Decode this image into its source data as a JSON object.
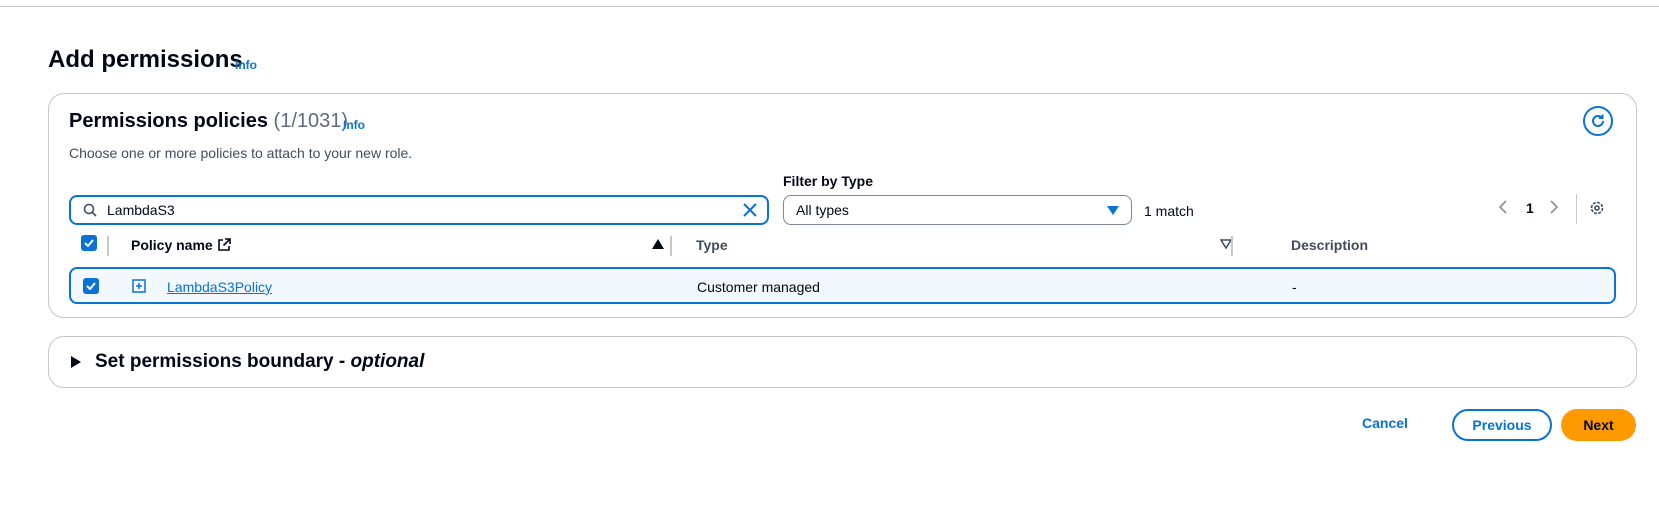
{
  "page": {
    "title": "Add permissions",
    "info": "Info"
  },
  "policies": {
    "title": "Permissions policies",
    "count": "(1/1031)",
    "info": "Info",
    "description": "Choose one or more policies to attach to your new role.",
    "search_value": "LambdaS3",
    "filter_label": "Filter by Type",
    "filter_value": "All types",
    "match_text": "1 match",
    "page_number": "1",
    "columns": [
      "Policy name",
      "Type",
      "Description"
    ],
    "rows": [
      {
        "checked": true,
        "name": "LambdaS3Policy",
        "type": "Customer managed",
        "description": "-"
      }
    ]
  },
  "boundary": {
    "title": "Set permissions boundary - ",
    "optional": "optional"
  },
  "actions": {
    "cancel": "Cancel",
    "previous": "Previous",
    "next": "Next"
  },
  "colors": {
    "accent": "#0972d3",
    "primary_button": "#ff9900",
    "selected_row": "#f2f8fd",
    "border": "#c6c6cd"
  }
}
